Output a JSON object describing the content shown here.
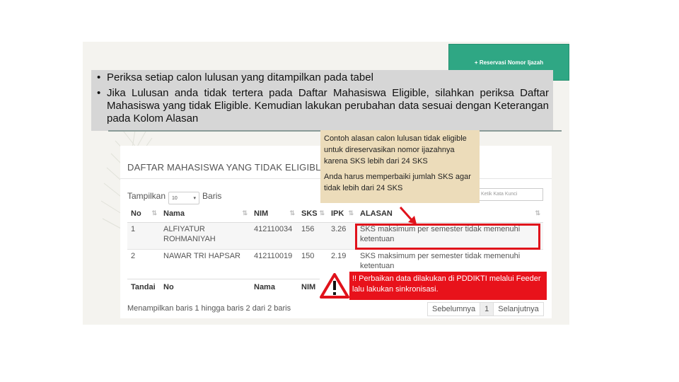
{
  "header": {
    "reserve_button_label": "+ Reservasi Nomor Ijazah"
  },
  "note": {
    "bullets": [
      "Periksa setiap calon lulusan yang ditampilkan pada tabel",
      "Jika Lulusan anda tidak tertera pada Daftar Mahasiswa Eligible, silahkan periksa Daftar Mahasiswa yang tidak Eligible. Kemudian lakukan perubahan data sesuai dengan Keterangan pada Kolom Alasan"
    ],
    "bullet_glyph": "•"
  },
  "callout": {
    "line1": "Contoh alasan calon lulusan tidak eligible untuk direservasikan nomor ijazahnya karena SKS lebih dari 24 SKS",
    "line2": "Anda harus memperbaiki jumlah SKS agar tidak lebih dari 24 SKS"
  },
  "panel": {
    "title": "DAFTAR MAHASISWA YANG TIDAK ELIGIBLE",
    "show_label": "Tampilkan",
    "rows_label": "Baris",
    "page_size": "10",
    "search_placeholder": "Ketik Kata Kunci"
  },
  "table": {
    "headers": [
      "No",
      "Nama",
      "NIM",
      "SKS",
      "IPK",
      "ALASAN"
    ],
    "footer": [
      "Tandai",
      "No",
      "Nama",
      "NIM",
      "",
      ""
    ],
    "rows": [
      {
        "no": "1",
        "nama": "ALFIYATUR ROHMANIYAH",
        "nim": "412110034",
        "sks": "156",
        "ipk": "3.26",
        "alasan": "SKS maksimum per semester tidak memenuhi ketentuan"
      },
      {
        "no": "2",
        "nama": "NAWAR TRI HAPSAR",
        "nim": "412110019",
        "sks": "150",
        "ipk": "2.19",
        "alasan": "SKS maksimum per semester tidak memenuhi ketentuan"
      }
    ]
  },
  "footer": {
    "info": "Menampilkan baris 1 hingga baris 2 dari 2 baris",
    "prev": "Sebelumnya",
    "page": "1",
    "next": "Selanjutnya"
  },
  "alert": {
    "text": "!! Perbaikan data dilakukan di PDDIKTI melalui Feeder lalu lakukan sinkronisasi.",
    "icon": "warning-icon"
  },
  "colors": {
    "accent": "#2fa784",
    "alert_red": "#e8121b",
    "callout_bg": "#ecdcba",
    "note_bg": "#d6d6d6"
  }
}
